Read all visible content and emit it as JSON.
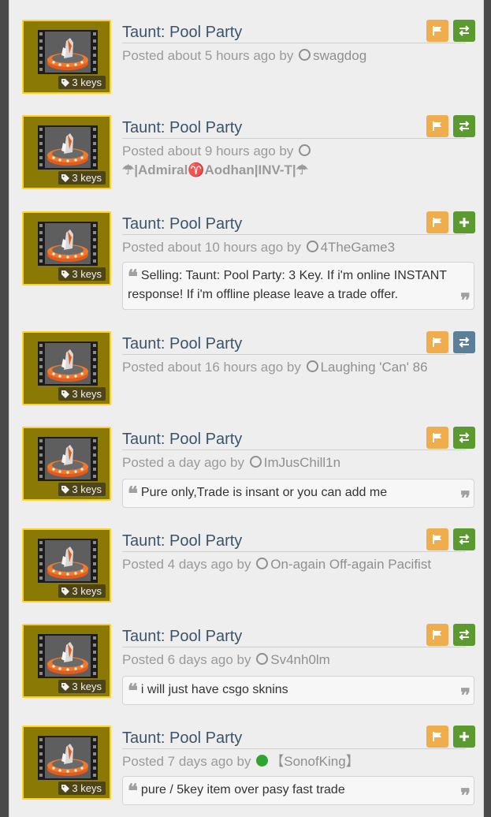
{
  "listings": [
    {
      "title": "Taunt: Pool Party",
      "keys": "3 keys",
      "posted": "Posted about 5 hours ago by",
      "user": "swagdog",
      "action": "trade",
      "action_color": "#5b9a2e",
      "online": false,
      "note": ""
    },
    {
      "title": "Taunt: Pool Party",
      "keys": "3 keys",
      "posted": "Posted about 9 hours ago by",
      "user": "☂|Admiral♈Aodhan|INV-T|☂",
      "action": "trade",
      "action_color": "#5b9a2e",
      "online": false,
      "note": ""
    },
    {
      "title": "Taunt: Pool Party",
      "keys": "3 keys",
      "posted": "Posted about 10 hours ago by",
      "user": "4TheGame3",
      "action": "add",
      "action_color": "#5b9a2e",
      "online": false,
      "note": "Selling: Taunt: Pool Party: 3 Key. If i'm online INSTANT response! If i'm offline please leave a trade offer."
    },
    {
      "title": "Taunt: Pool Party",
      "keys": "3 keys",
      "posted": "Posted about 16 hours ago by",
      "user": "Laughing 'Can' 86",
      "action": "trade",
      "action_color": "#5c7f99",
      "online": false,
      "note": ""
    },
    {
      "title": "Taunt: Pool Party",
      "keys": "3 keys",
      "posted": "Posted a day ago by",
      "user": "ImJusChill1n",
      "action": "trade",
      "action_color": "#5b9a2e",
      "online": false,
      "note": "Pure only,Trade is insant or you can add me"
    },
    {
      "title": "Taunt: Pool Party",
      "keys": "3 keys",
      "posted": "Posted 4 days ago by",
      "user": "On-again Off-again Pacifist",
      "action": "trade",
      "action_color": "#5b9a2e",
      "online": false,
      "note": ""
    },
    {
      "title": "Taunt: Pool Party",
      "keys": "3 keys",
      "posted": "Posted 6 days ago by",
      "user": "Sv4nh0lm",
      "action": "trade",
      "action_color": "#5b9a2e",
      "online": false,
      "note": "i will just have csgo sknins"
    },
    {
      "title": "Taunt: Pool Party",
      "keys": "3 keys",
      "posted": "Posted 7 days ago by",
      "user": "【SonofKing】",
      "action": "add",
      "action_color": "#5b9a2e",
      "online": true,
      "note": "pure / 5key item over pasy fast trade"
    }
  ],
  "colors": {
    "flag": "#f0ad4e",
    "border": "#ffd02a",
    "thumb_bg": "#8a7a05"
  },
  "icons": {
    "flag": "flag-icon",
    "trade": "exchange-icon",
    "add": "plus-icon",
    "tag": "tag-icon",
    "user": "user-status-icon",
    "quote_open": "quote-left-icon",
    "quote_close": "quote-right-icon"
  }
}
